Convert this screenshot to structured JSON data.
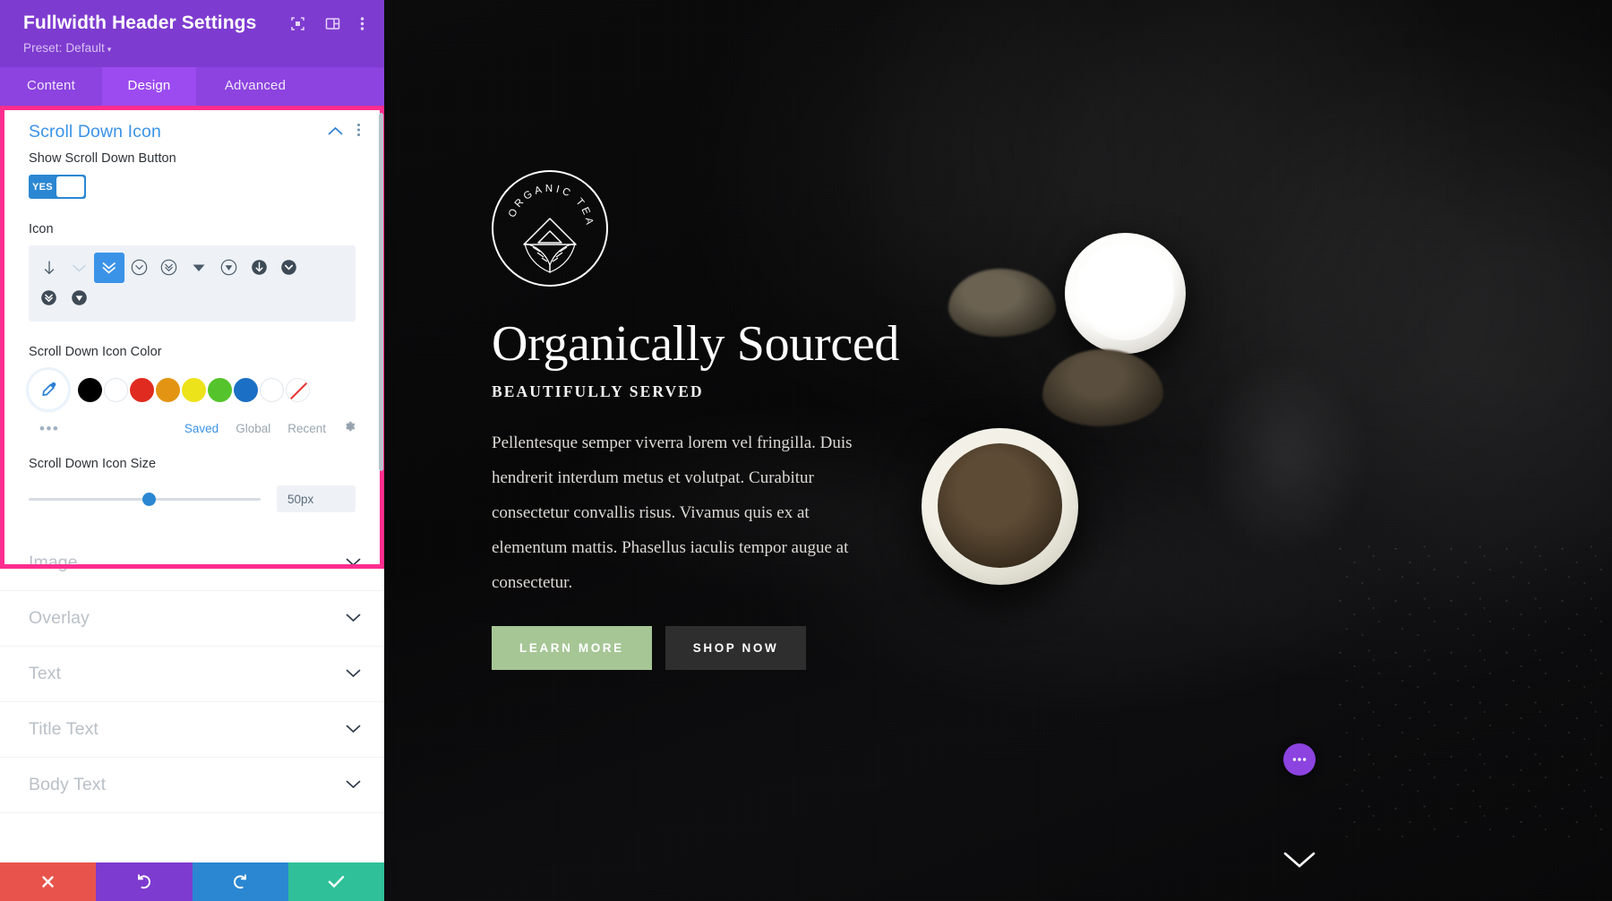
{
  "panel": {
    "title": "Fullwidth Header Settings",
    "preset_label": "Preset: Default",
    "header_icons": [
      {
        "name": "responsive-preview-icon"
      },
      {
        "name": "panel-layout-icon"
      },
      {
        "name": "more-options-icon"
      }
    ],
    "tabs": [
      {
        "label": "Content",
        "active": false
      },
      {
        "label": "Design",
        "active": true
      },
      {
        "label": "Advanced",
        "active": false
      }
    ],
    "open_section": {
      "title": "Scroll Down Icon",
      "collapse_icon": "chevron-up-icon",
      "options_icon": "kebab-menu-icon",
      "fields": {
        "show_button": {
          "label": "Show Scroll Down Button",
          "toggle_value": "YES"
        },
        "icon": {
          "label": "Icon",
          "row1": [
            {
              "glyph": "↓",
              "name": "arrow-down-icon",
              "selected": false,
              "pale": false
            },
            {
              "glyph": "⌄",
              "name": "chevron-down-thin-icon",
              "selected": false,
              "pale": true
            },
            {
              "glyph": "»",
              "name": "double-chevron-down-icon",
              "selected": true,
              "pale": false
            },
            {
              "glyph": "⌄",
              "name": "circle-chevron-down-icon",
              "selected": false,
              "pale": false
            },
            {
              "glyph": "»",
              "name": "circle-double-chevron-down-icon",
              "selected": false,
              "pale": false
            },
            {
              "glyph": "▼",
              "name": "triangle-down-icon",
              "selected": false,
              "pale": false
            },
            {
              "glyph": "▼",
              "name": "circle-triangle-down-icon",
              "selected": false,
              "pale": false
            },
            {
              "glyph": "↓",
              "name": "filled-circle-arrow-down-icon",
              "selected": false,
              "pale": false
            },
            {
              "glyph": "⌄",
              "name": "filled-circle-chevron-down-icon",
              "selected": false,
              "pale": false
            }
          ],
          "row2": [
            {
              "glyph": "»",
              "name": "filled-circle-double-chevron-down-icon",
              "selected": false,
              "pale": false
            },
            {
              "glyph": "▼",
              "name": "filled-circle-triangle-down-icon",
              "selected": false,
              "pale": false
            }
          ]
        },
        "color": {
          "label": "Scroll Down Icon Color",
          "picker_icon": "eyedropper-icon",
          "swatches": [
            {
              "hex": "#000000",
              "name": "swatch-black"
            },
            {
              "hex": "#ffffff",
              "name": "swatch-white"
            },
            {
              "hex": "#e02b20",
              "name": "swatch-red"
            },
            {
              "hex": "#e39412",
              "name": "swatch-orange"
            },
            {
              "hex": "#ede31a",
              "name": "swatch-yellow"
            },
            {
              "hex": "#55c32b",
              "name": "swatch-green"
            },
            {
              "hex": "#1b6fc4",
              "name": "swatch-blue"
            },
            {
              "hex": "#ffffff",
              "name": "swatch-white-outline"
            },
            {
              "hex": "transparent",
              "name": "swatch-none"
            }
          ],
          "more_icon": "more-colors-icon",
          "links": [
            {
              "label": "Saved",
              "active": true
            },
            {
              "label": "Global",
              "active": false
            },
            {
              "label": "Recent",
              "active": false
            }
          ],
          "settings_icon": "gear-icon"
        },
        "size": {
          "label": "Scroll Down Icon Size",
          "value": "50px",
          "slider_percent": 49
        }
      }
    },
    "closed_sections": [
      {
        "label": "Image",
        "icon": "chevron-down-icon"
      },
      {
        "label": "Overlay",
        "icon": "chevron-down-icon"
      },
      {
        "label": "Text",
        "icon": "chevron-down-icon"
      },
      {
        "label": "Title Text",
        "icon": "chevron-down-icon"
      },
      {
        "label": "Body Text",
        "icon": "chevron-down-icon"
      }
    ],
    "bottom_bar": [
      {
        "name": "cancel-button",
        "icon": "close-x-icon",
        "color": "#e8544b"
      },
      {
        "name": "undo-button",
        "icon": "undo-arrow-icon",
        "color": "#7e3bd0"
      },
      {
        "name": "redo-button",
        "icon": "redo-arrow-icon",
        "color": "#2b87d2"
      },
      {
        "name": "save-button",
        "icon": "checkmark-icon",
        "color": "#2fc099"
      }
    ],
    "accent_highlight_color": "#ff2d8e"
  },
  "preview": {
    "logo": {
      "arc_text": "ORGANIC TEA",
      "emblem": "mountain-leaves-emblem"
    },
    "title": "Organically Sourced",
    "subtitle": "BEAUTIFULLY SERVED",
    "body": "Pellentesque semper viverra lorem vel fringilla. Duis hendrerit interdum metus et volutpat. Curabitur consectetur convallis risus. Vivamus quis ex at elementum mattis. Phasellus iaculis tempor augue at consectetur.",
    "buttons": [
      {
        "label": "LEARN MORE",
        "name": "learn-more-button",
        "color": "#a6c695"
      },
      {
        "label": "SHOP NOW",
        "name": "shop-now-button",
        "color": "#2e2e2e"
      }
    ],
    "fab_icon": "ellipsis-icon",
    "scroll_down_icon": "chevron-down-icon"
  }
}
